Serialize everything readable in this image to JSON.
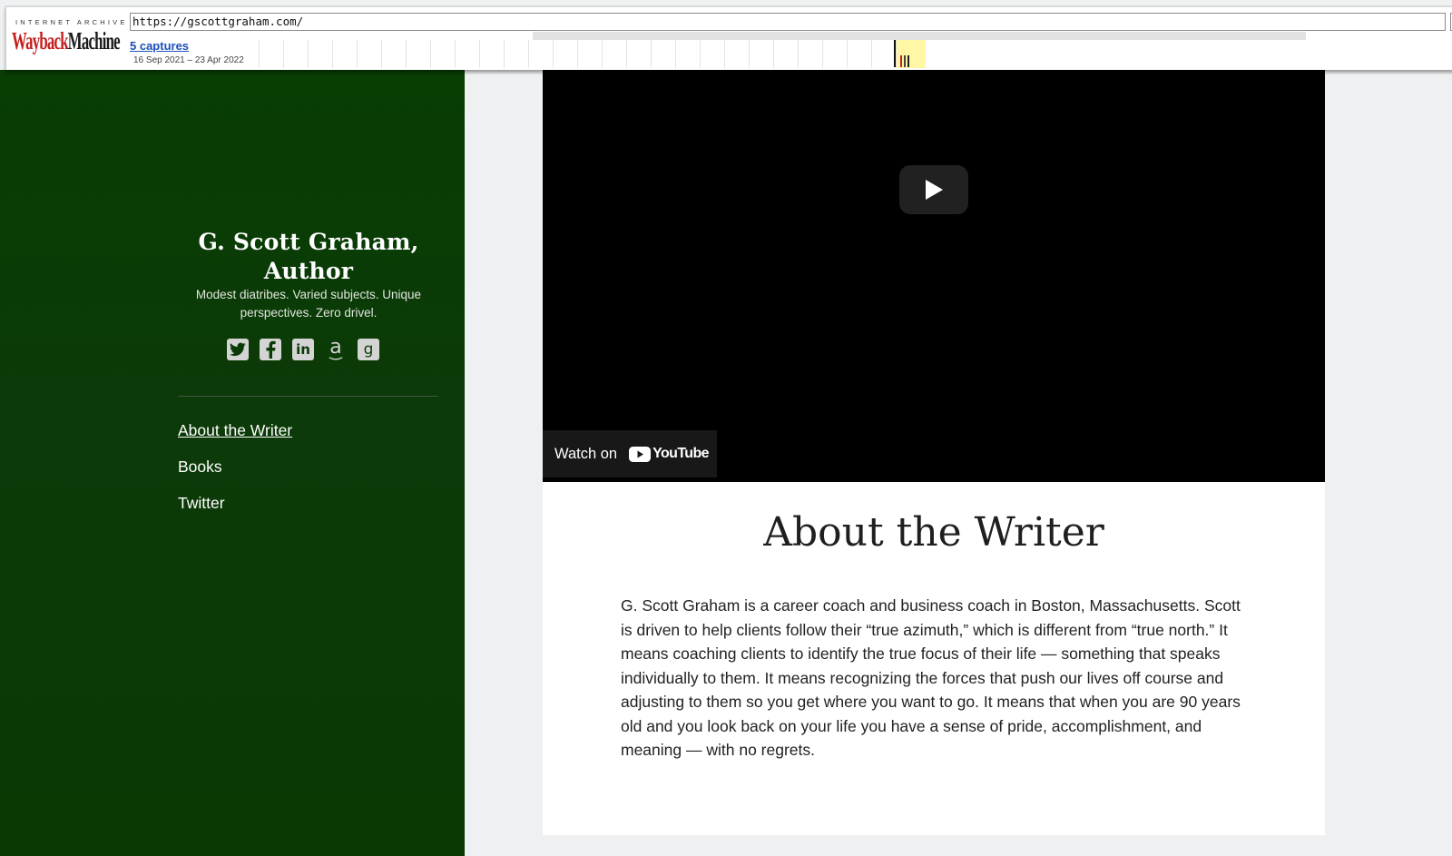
{
  "wayback": {
    "logo_top": "INTERNET ARCHIVE",
    "logo_wayback": "Wayback",
    "logo_machine": "Machine",
    "url": "https://gscottgraham.com/",
    "captures": "5 captures",
    "date_range": "16 Sep 2021 – 23 Apr 2022"
  },
  "site": {
    "title": "G. Scott Graham, Author",
    "description": "Modest diatribes. Varied subjects. Unique perspectives. Zero drivel.",
    "social": [
      {
        "icon": "twitter-icon"
      },
      {
        "icon": "facebook-icon"
      },
      {
        "icon": "linkedin-icon",
        "glyph": "in"
      },
      {
        "icon": "amazon-icon",
        "glyph": "a"
      },
      {
        "icon": "goodreads-icon",
        "glyph": "g"
      }
    ]
  },
  "nav": {
    "items": [
      {
        "label": "About the Writer",
        "active": true
      },
      {
        "label": "Books"
      },
      {
        "label": "Twitter"
      }
    ]
  },
  "video": {
    "watch_label": "Watch on",
    "youtube_word": "YouTube"
  },
  "page": {
    "title": "About the Writer",
    "body": "G. Scott Graham is a career coach and business coach in Boston, Massachusetts. Scott is driven to help clients follow their “true azimuth,” which is different from “true north.” It means coaching clients to identify the true focus of their life — something that speaks individually to them. It means recognizing the forces that push our lives off course and adjusting to them so you get where you want to go. It means that when you are 90 years old and you look back on your life you have a sense of pride, accomplishment, and meaning — with no regrets."
  },
  "colors": {
    "sidebar": "#0a3b06",
    "background": "#eff0f1",
    "link_blue": "#1a4fb8",
    "wayback_red": "#c41e1e",
    "highlight": "#fff7a3"
  }
}
